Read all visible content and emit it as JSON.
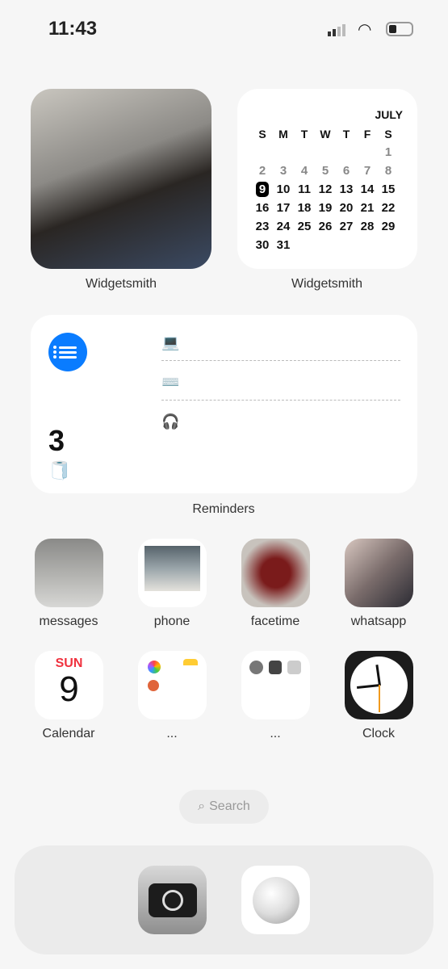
{
  "status": {
    "time": "11:43",
    "battery_level": 0.35
  },
  "widgets": {
    "photo_label": "Widgetsmith",
    "calendar_label": "Widgetsmith",
    "calendar": {
      "month": "JULY",
      "weekdays": [
        "S",
        "M",
        "T",
        "W",
        "T",
        "F",
        "S"
      ],
      "today": 9,
      "weeks": [
        [
          "",
          "",
          "",
          "",
          "",
          "",
          "1"
        ],
        [
          "2",
          "3",
          "4",
          "5",
          "6",
          "7",
          "8"
        ],
        [
          "9",
          "10",
          "11",
          "12",
          "13",
          "14",
          "15"
        ],
        [
          "16",
          "17",
          "18",
          "19",
          "20",
          "21",
          "22"
        ],
        [
          "23",
          "24",
          "25",
          "26",
          "27",
          "28",
          "29"
        ],
        [
          "30",
          "31",
          "",
          "",
          "",
          "",
          ""
        ]
      ]
    },
    "reminders": {
      "label": "Reminders",
      "count": "3",
      "count_icon": "🧻",
      "items": [
        "💻",
        "⌨️",
        "🎧"
      ],
      "accent": "#0a7cff"
    }
  },
  "apps": [
    {
      "label": "messages",
      "icon": "photo-feet"
    },
    {
      "label": "phone",
      "icon": "photo-beach"
    },
    {
      "label": "facetime",
      "icon": "photo-cherries"
    },
    {
      "label": "whatsapp",
      "icon": "photo-person"
    },
    {
      "label": "Calendar",
      "icon": "calendar",
      "day": "SUN",
      "date": "9"
    },
    {
      "label": "...",
      "icon": "folder"
    },
    {
      "label": "...",
      "icon": "folder"
    },
    {
      "label": "Clock",
      "icon": "clock"
    }
  ],
  "search": {
    "label": "Search"
  },
  "dock": [
    {
      "name": "camera"
    },
    {
      "name": "glass-orb"
    }
  ]
}
